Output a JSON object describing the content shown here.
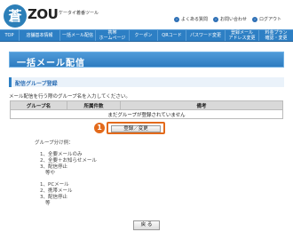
{
  "header": {
    "logo_glyph": "蒼",
    "brand": "ZOU",
    "tagline": "ケータイ着番ツール",
    "links": [
      {
        "label": "よくある質問",
        "icon": "arrow-icon"
      },
      {
        "label": "お問い合わせ",
        "icon": "arrow-icon"
      },
      {
        "label": "ログアウト",
        "icon": "arrow-icon"
      }
    ]
  },
  "nav": [
    {
      "label": "TOP"
    },
    {
      "label": "店舗基本情報"
    },
    {
      "label": "一括メール配信"
    },
    {
      "label": "携帯\nホームページ"
    },
    {
      "label": "クーポン"
    },
    {
      "label": "QRコード"
    },
    {
      "label": "パスワード変更"
    },
    {
      "label": "登録メール\nアドレス変更"
    },
    {
      "label": "料金プラン\n確認・変更"
    }
  ],
  "page": {
    "title": "一括メール配信",
    "section_title": "配信グループ登録",
    "instruction": "メール配信を行う際のグループ名を入力してください。"
  },
  "table": {
    "headers": [
      "グループ名",
      "所属件数",
      "備考"
    ],
    "empty_message": "まだグループが登録されていません"
  },
  "actions": {
    "register_label": "登録／変更",
    "badge": "1",
    "back_label": "戻 る"
  },
  "examples": {
    "heading": "グループ分け例：",
    "list1": [
      "1、全要メールのみ",
      "2、全要＋お知らせメール",
      "3、配信停止",
      "等や"
    ],
    "list2": [
      "1、PCメール",
      "2、携帯メール",
      "3、配信停止",
      "等"
    ]
  },
  "colors": {
    "accent": "#2d7fc4",
    "highlight": "#e36a1b"
  }
}
